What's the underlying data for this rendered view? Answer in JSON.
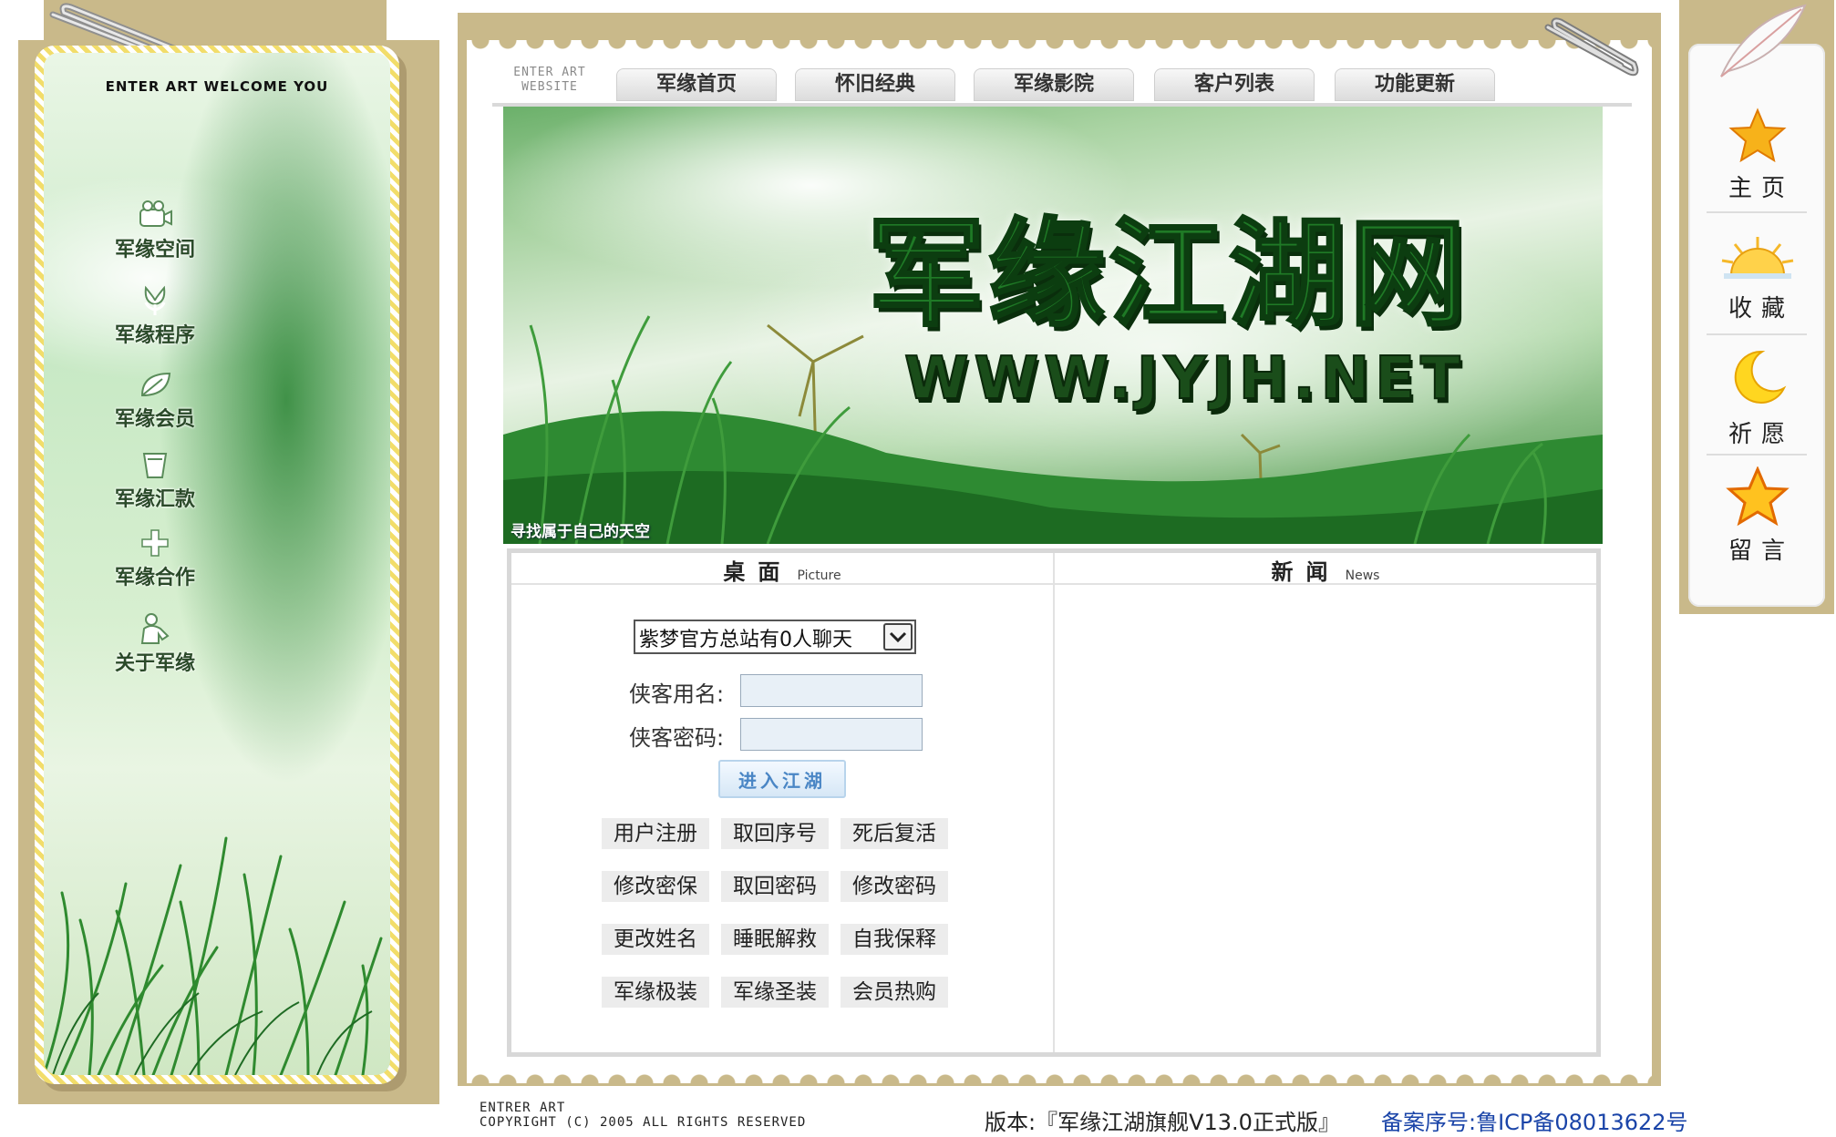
{
  "left_panel": {
    "welcome": "ENTER ART WELCOME YOU",
    "items": [
      {
        "label": "军缘空间",
        "icon": "camera-icon"
      },
      {
        "label": "军缘程序",
        "icon": "tulip-icon"
      },
      {
        "label": "军缘会员",
        "icon": "leaf-icon"
      },
      {
        "label": "军缘汇款",
        "icon": "bucket-icon"
      },
      {
        "label": "军缘合作",
        "icon": "plus-icon"
      },
      {
        "label": "关于军缘",
        "icon": "person-icon"
      }
    ]
  },
  "top_nav": {
    "logo_line1": "ENTER ART",
    "logo_line2": "WEBSITE",
    "tabs": [
      {
        "label": "军缘首页"
      },
      {
        "label": "怀旧经典"
      },
      {
        "label": "军缘影院"
      },
      {
        "label": "客户列表"
      },
      {
        "label": "功能更新"
      }
    ]
  },
  "banner": {
    "title": "军缘江湖网",
    "url": "WWW.JYJH.NET",
    "caption": "寻找属于自己的天空"
  },
  "panels": {
    "left": {
      "title_cn": "桌面",
      "title_en": "Picture"
    },
    "right": {
      "title_cn": "新闻",
      "title_en": "News"
    }
  },
  "login": {
    "server_selected": "紫梦官方总站有0人聊天",
    "username_label": "侠客用名:",
    "username_value": "",
    "password_label": "侠客密码:",
    "password_value": "",
    "submit_label": "进入江湖",
    "buttons": [
      {
        "label": "用户注册"
      },
      {
        "label": "取回序号"
      },
      {
        "label": "死后复活"
      },
      {
        "label": "修改密保"
      },
      {
        "label": "取回密码"
      },
      {
        "label": "修改密码"
      },
      {
        "label": "更改姓名"
      },
      {
        "label": "睡眠解救"
      },
      {
        "label": "自我保释"
      },
      {
        "label": "军缘极装"
      },
      {
        "label": "军缘圣装"
      },
      {
        "label": "会员热购"
      }
    ]
  },
  "right_nav": {
    "items": [
      {
        "label": "主页",
        "icon": "star-icon"
      },
      {
        "label": "收藏",
        "icon": "sun-icon"
      },
      {
        "label": "祈愿",
        "icon": "moon-icon"
      },
      {
        "label": "留言",
        "icon": "star-icon"
      }
    ]
  },
  "footer": {
    "copyright_line1": "ENTRER ART",
    "copyright_line2": "COPYRIGHT (C) 2005 ALL RIGHTS RESERVED",
    "version": "版本:『军缘江湖旗舰V13.0正式版』",
    "icp": "备案序号:鲁ICP备08013622号"
  },
  "colors": {
    "frame": "#c9b98a",
    "grass_green": "#2f8a2f",
    "link_blue": "#1a44a8"
  }
}
